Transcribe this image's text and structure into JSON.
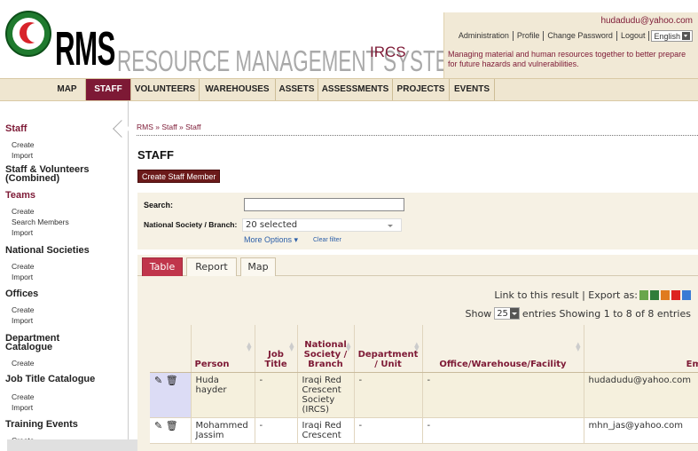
{
  "header": {
    "brand_rms": "RMS",
    "brand_full": "RESOURCE MANAGEMENT SYSTEM",
    "brand_org": "IRCS",
    "user_email": "hudadudu@yahoo.com",
    "links": [
      "Administration",
      "Profile",
      "Change Password",
      "Logout"
    ],
    "language": "English",
    "tagline": "Managing material and human resources together to better prepare for future hazards and vulnerabilities."
  },
  "nav": [
    "MAP",
    "STAFF",
    "VOLUNTEERS",
    "WAREHOUSES",
    "ASSETS",
    "ASSESSMENTS",
    "PROJECTS",
    "EVENTS"
  ],
  "nav_active": "STAFF",
  "sidebar": {
    "staff": "Staff",
    "staff_items": [
      "Create",
      "Import"
    ],
    "combined": "Staff & Volunteers (Combined)",
    "teams": "Teams",
    "teams_items": [
      "Create",
      "Search Members",
      "Import"
    ],
    "national": "National Societies",
    "national_items": [
      "Create",
      "Import"
    ],
    "offices": "Offices",
    "offices_items": [
      "Create",
      "Import"
    ],
    "dept": "Department Catalogue",
    "dept_items": [
      "Create"
    ],
    "jobtitle": "Job Title Catalogue",
    "jobtitle_items": [
      "Create",
      "Import"
    ],
    "training": "Training Events",
    "training_items": [
      "Create"
    ]
  },
  "main": {
    "breadcrumb": "RMS » Staff » Staff",
    "title": "STAFF",
    "create_button": "Create Staff Member",
    "filter": {
      "search_label": "Search:",
      "search_value": "",
      "ns_label": "National Society / Branch:",
      "ns_value": "20 selected",
      "more_options": "More Options ▾",
      "clear_filter": "Clear filter"
    },
    "tabs": [
      "Table",
      "Report",
      "Map"
    ],
    "active_tab": "Table",
    "export_text": "Link to this result | Export as:",
    "show_label": "Show",
    "page_size": "25",
    "entries_text": "entries Showing 1 to 8 of 8 entries",
    "columns": [
      "",
      "Person",
      "Job Title",
      "National Society / Branch",
      "Department / Unit",
      "Office/Warehouse/Facility",
      "Email"
    ],
    "rows": [
      {
        "person": "Huda hayder",
        "job": "-",
        "ns": "Iraqi Red Crescent Society (IRCS)",
        "dept": "-",
        "office": "-",
        "email": "hudadudu@yahoo.com"
      },
      {
        "person": "Mohammed Jassim",
        "job": "-",
        "ns": "Iraqi Red Crescent",
        "dept": "-",
        "office": "-",
        "email": "mhn_jas@yahoo.com"
      }
    ]
  },
  "colors": {
    "accent": "#7d1935",
    "nav_bg": "#efe6d0",
    "panel_bg": "#f6f1e4",
    "tab_active": "#c0354b"
  }
}
